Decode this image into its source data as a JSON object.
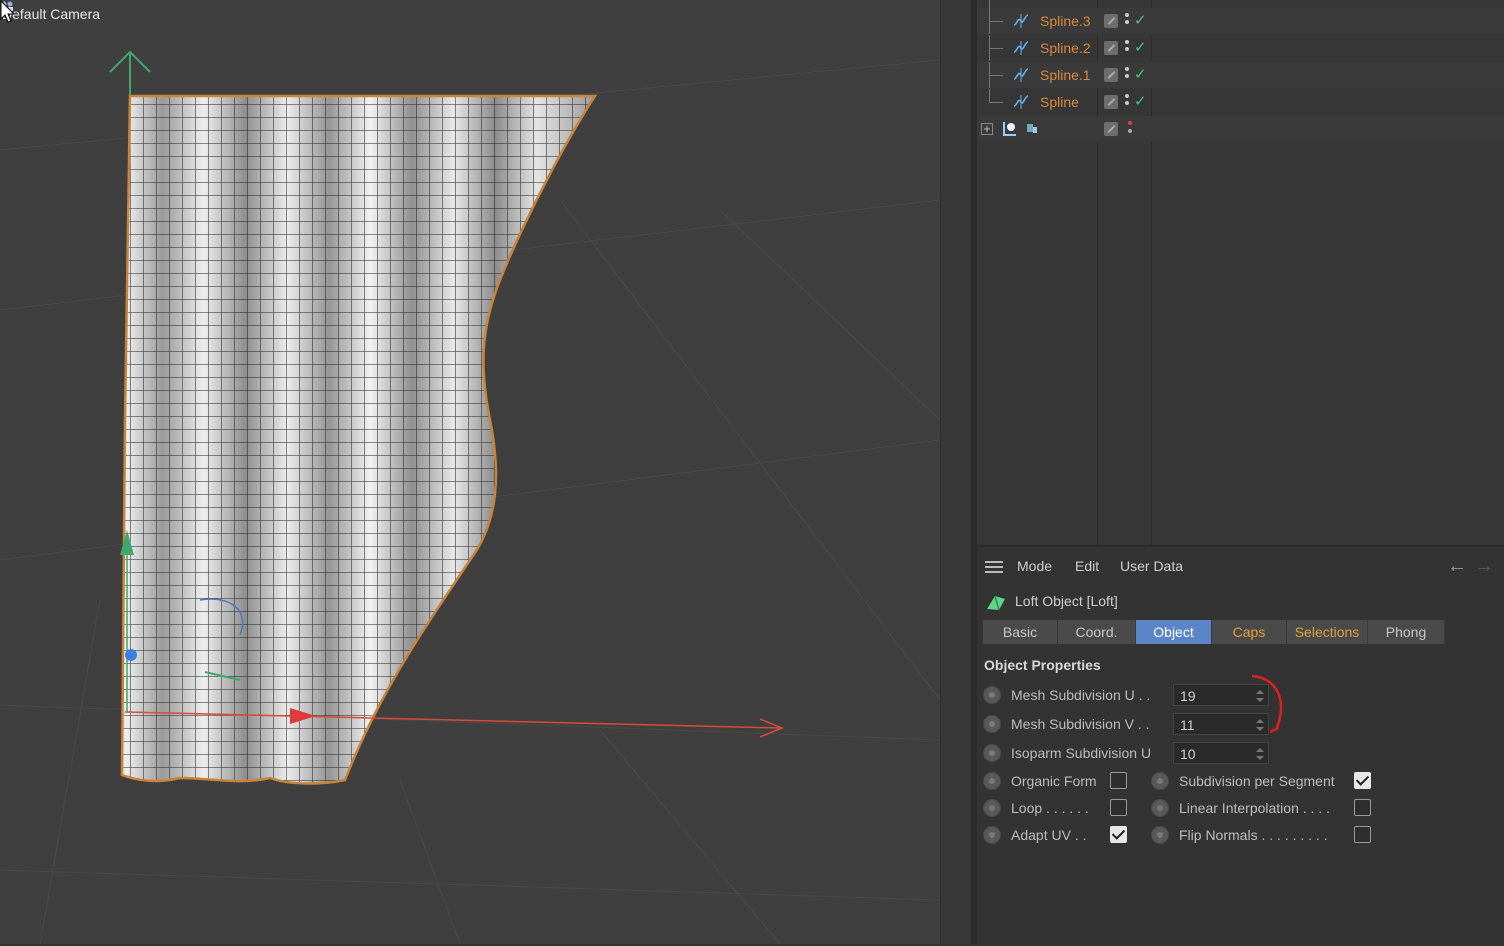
{
  "viewport": {
    "camera_label": "Default Camera"
  },
  "object_manager": {
    "rows": [
      {
        "name": "Spline.3",
        "type": "spline",
        "status": "check"
      },
      {
        "name": "Spline.2",
        "type": "spline",
        "status": "check"
      },
      {
        "name": "Spline.1",
        "type": "spline",
        "status": "check"
      },
      {
        "name": "Spline",
        "type": "spline",
        "status": "check"
      }
    ]
  },
  "attributes": {
    "menu": {
      "mode": "Mode",
      "edit": "Edit",
      "user_data": "User Data"
    },
    "object_title": "Loft Object [Loft]",
    "tabs": [
      {
        "label": "Basic",
        "active": false,
        "color": "#c8c8c8"
      },
      {
        "label": "Coord.",
        "active": false,
        "color": "#c8c8c8"
      },
      {
        "label": "Object",
        "active": true,
        "color": "#ffffff"
      },
      {
        "label": "Caps",
        "active": false,
        "color": "#e2a13c"
      },
      {
        "label": "Selections",
        "active": false,
        "color": "#e2a13c"
      },
      {
        "label": "Phong",
        "active": false,
        "color": "#c8c8c8"
      }
    ],
    "section_title": "Object Properties",
    "fields": [
      {
        "label": "Mesh Subdivision U . .",
        "value": "19"
      },
      {
        "label": "Mesh Subdivision V . .",
        "value": "11"
      },
      {
        "label": "Isoparm Subdivision U",
        "value": "10"
      }
    ],
    "checks_left": [
      {
        "label": "Organic Form",
        "checked": false
      },
      {
        "label": "Loop . . . . . .",
        "checked": false
      },
      {
        "label": "Adapt UV . .",
        "checked": true
      }
    ],
    "checks_right": [
      {
        "label": "Subdivision per Segment",
        "checked": true
      },
      {
        "label": "Linear Interpolation . . . .",
        "checked": false
      },
      {
        "label": "Flip Normals . . . . . . . . .",
        "checked": false
      }
    ]
  },
  "colors": {
    "accent": "#5a86c8",
    "orange_text": "#d98a3d",
    "check_green": "#45c878",
    "annotation_red": "#e02020"
  }
}
